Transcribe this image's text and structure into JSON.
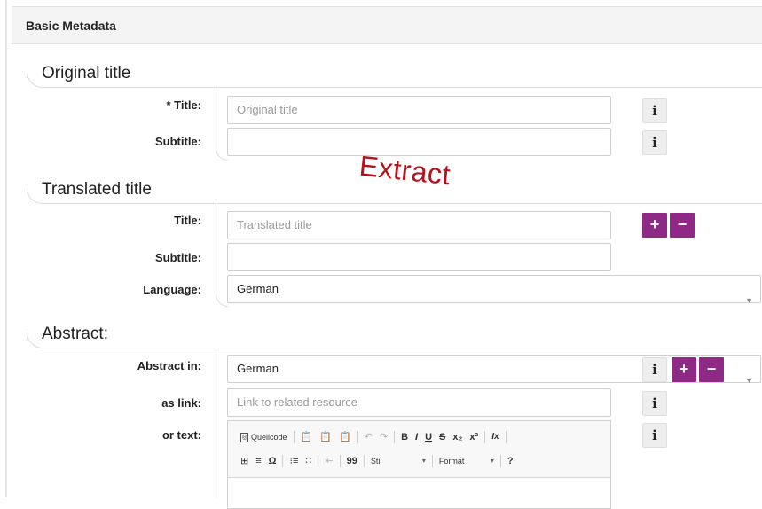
{
  "panel": {
    "title": "Basic Metadata"
  },
  "original_title": {
    "heading": "Original title",
    "title_label": "* Title:",
    "title_placeholder": "Original title",
    "subtitle_label": "Subtitle:",
    "subtitle_value": ""
  },
  "overlay": {
    "text": "Extract",
    "color": "#b5121b"
  },
  "translated_title": {
    "heading": "Translated title",
    "title_label": "Title:",
    "title_placeholder": "Translated title",
    "subtitle_label": "Subtitle:",
    "subtitle_value": "",
    "language_label": "Language:",
    "language_value": "German"
  },
  "abstract": {
    "heading": "Abstract:",
    "abstract_in_label": "Abstract in:",
    "abstract_in_value": "German",
    "as_link_label": "as link:",
    "as_link_placeholder": "Link to related resource",
    "or_text_label": "or text:"
  },
  "buttons": {
    "info": "i",
    "add": "+",
    "remove": "−"
  },
  "editor_toolbar": {
    "source_label": "Quellcode",
    "undo": "↶",
    "redo": "↷",
    "bold": "B",
    "italic": "I",
    "underline": "U",
    "strike": "S",
    "subscript": "x₂",
    "superscript": "x²",
    "remove_format": "Ix",
    "table": "⊞",
    "hr": "≡",
    "special_char": "Ω",
    "numbered_list": "⁝≡",
    "bulleted_list": "∷",
    "outdent": "⇤",
    "blockquote": "99",
    "style_label": "Stil",
    "format_label": "Format",
    "help": "?"
  },
  "colors": {
    "accent": "#8e2a86",
    "info_bg": "#eeeeee",
    "header_bg": "#f4f4f4"
  }
}
